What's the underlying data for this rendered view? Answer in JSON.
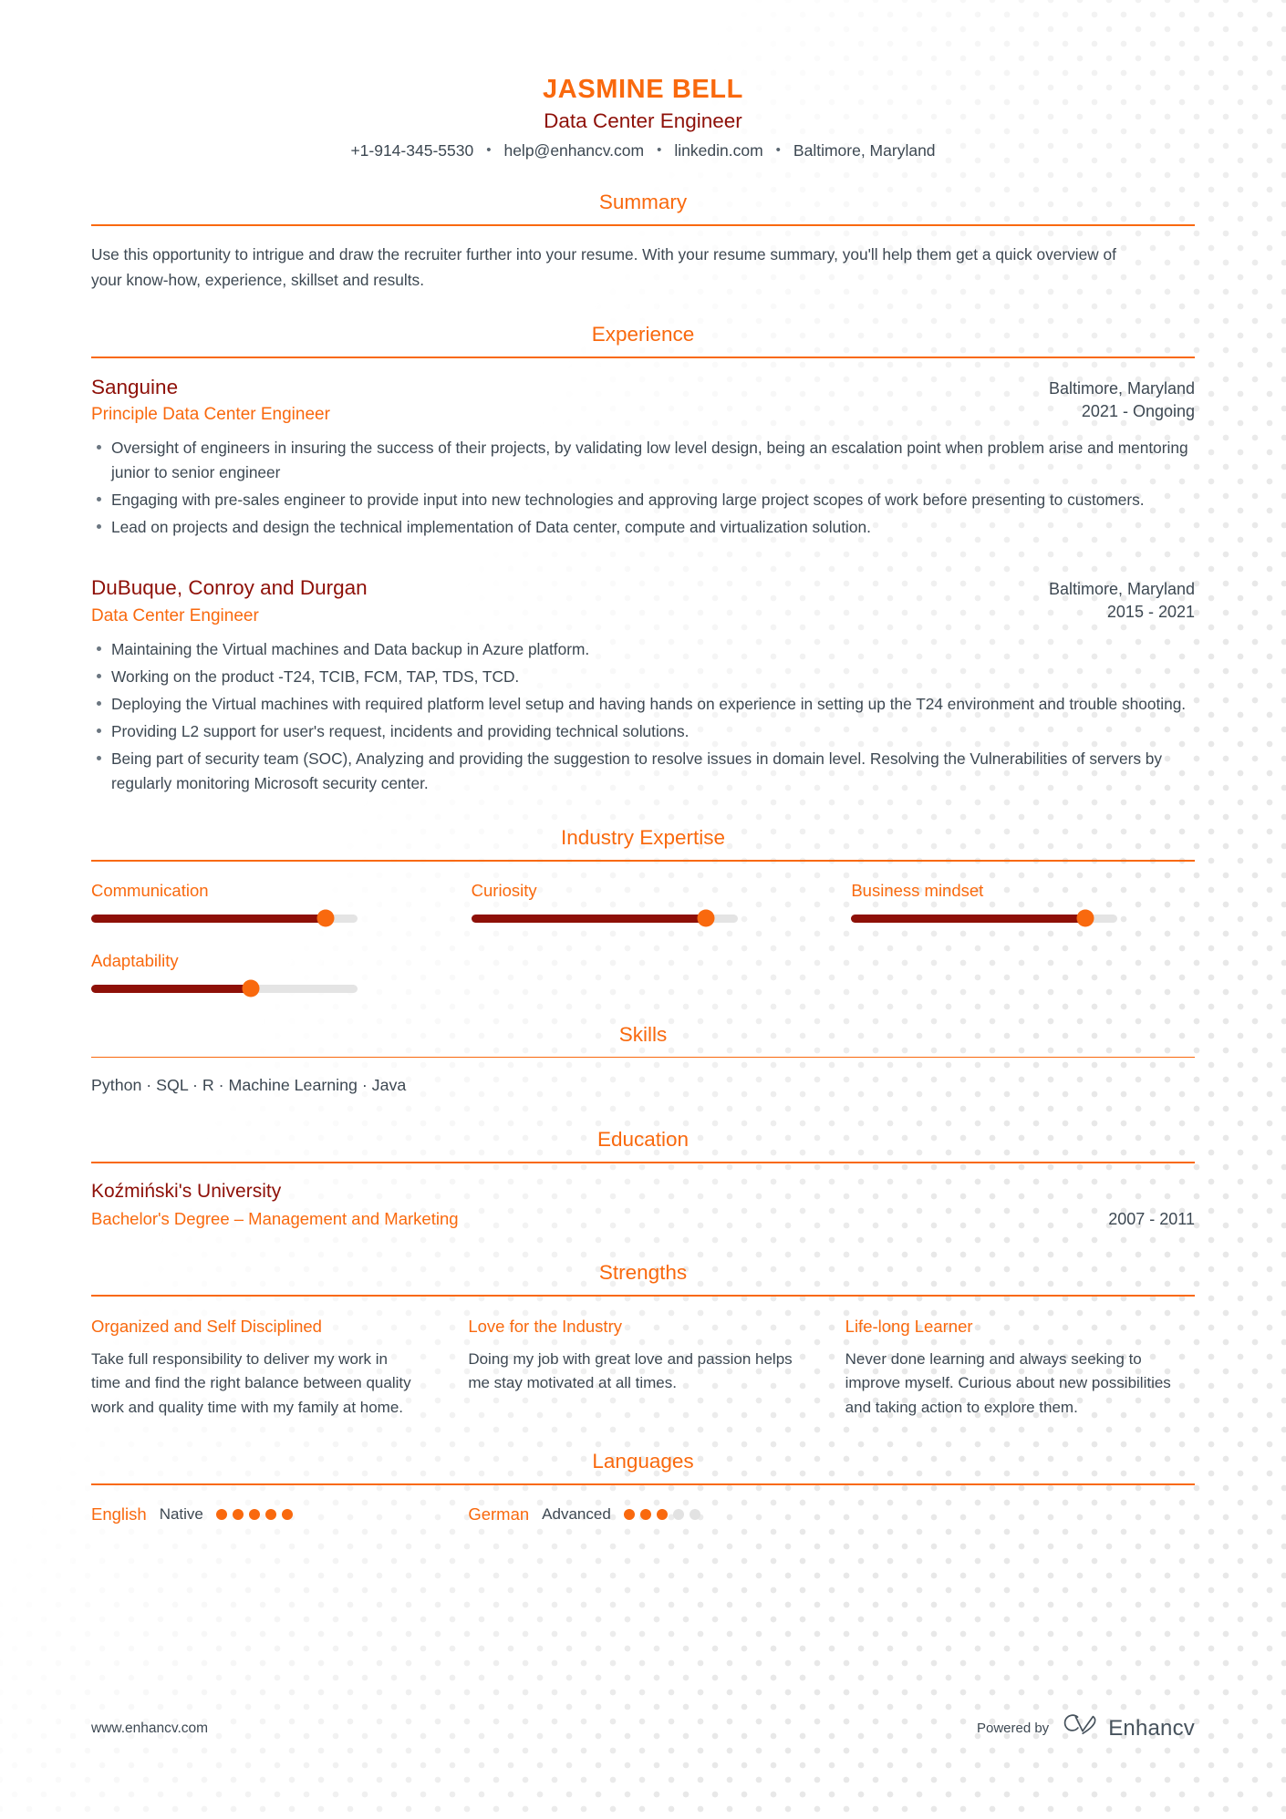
{
  "header": {
    "name": "JASMINE BELL",
    "job_title": "Data Center Engineer",
    "contacts": [
      {
        "name": "phone",
        "value": "+1-914-345-5530"
      },
      {
        "name": "email",
        "value": "help@enhancv.com"
      },
      {
        "name": "linkedin",
        "value": "linkedin.com"
      },
      {
        "name": "location",
        "value": "Baltimore, Maryland"
      }
    ],
    "separator": "•"
  },
  "sections": {
    "summary": {
      "title": "Summary",
      "text": "Use this opportunity to intrigue and draw the recruiter further into your resume. With your resume summary, you'll help them get a quick overview of your know-how, experience, skillset and results."
    },
    "experience": {
      "title": "Experience",
      "entries": [
        {
          "company": "Sanguine",
          "position": "Principle Data Center Engineer",
          "location": "Baltimore, Maryland",
          "dates": "2021 - Ongoing",
          "bullets": [
            "Oversight of engineers in insuring the success of their projects, by validating low level design, being an escalation point when problem arise and mentoring junior to senior engineer",
            "Engaging with pre-sales engineer to provide input into new technologies and approving large project scopes of work before presenting to customers.",
            "Lead on projects and design the technical implementation of Data center, compute and virtualization solution."
          ]
        },
        {
          "company": "DuBuque, Conroy and Durgan",
          "position": "Data Center Engineer",
          "location": "Baltimore, Maryland",
          "dates": "2015 - 2021",
          "bullets": [
            "Maintaining the Virtual machines and Data backup in Azure platform.",
            "Working on the product -T24, TCIB, FCM, TAP, TDS, TCD.",
            "Deploying the Virtual machines with required platform level setup and having hands on experience in setting up the T24 environment and trouble shooting.",
            "Providing L2 support for user's request, incidents and providing technical solutions.",
            "Being part of security team (SOC), Analyzing and providing the suggestion to resolve issues in domain level. Resolving the Vulnerabilities of servers by regularly monitoring Microsoft security center."
          ]
        }
      ]
    },
    "industry_expertise": {
      "title": "Industry Expertise",
      "items": [
        {
          "label": "Communication",
          "level": 88
        },
        {
          "label": "Curiosity",
          "level": 88
        },
        {
          "label": "Business mindset",
          "level": 88
        },
        {
          "label": "Adaptability",
          "level": 60
        }
      ]
    },
    "skills": {
      "title": "Skills",
      "text": "Python · SQL ·  R  · Machine Learning · Java"
    },
    "education": {
      "title": "Education",
      "entries": [
        {
          "school": "Koźmiński's University",
          "degree": "Bachelor's Degree – Management and Marketing",
          "dates": "2007 - 2011"
        }
      ]
    },
    "strengths": {
      "title": "Strengths",
      "items": [
        {
          "title": "Organized and Self Disciplined",
          "text": "Take full responsibility to deliver my work in time and find the right balance between quality work and quality time with my family at home."
        },
        {
          "title": "Love for the Industry",
          "text": "Doing my job with great love and passion helps me stay motivated at all times."
        },
        {
          "title": "Life-long Learner",
          "text": "Never done learning and always seeking to improve myself. Curious about new possibilities and taking action to explore them."
        }
      ]
    },
    "languages": {
      "title": "Languages",
      "items": [
        {
          "name": "English",
          "level": "Native",
          "rating": 5,
          "max": 5
        },
        {
          "name": "German",
          "level": "Advanced",
          "rating": 3,
          "max": 5
        }
      ]
    }
  },
  "footer": {
    "url": "www.enhancv.com",
    "powered_by": "Powered by",
    "brand_name": "Enhancv"
  },
  "colors": {
    "accent_orange": "#f9690e",
    "dark_red": "#8e1008",
    "body_text": "#3d4852",
    "track_gray": "#e4e4e4"
  }
}
